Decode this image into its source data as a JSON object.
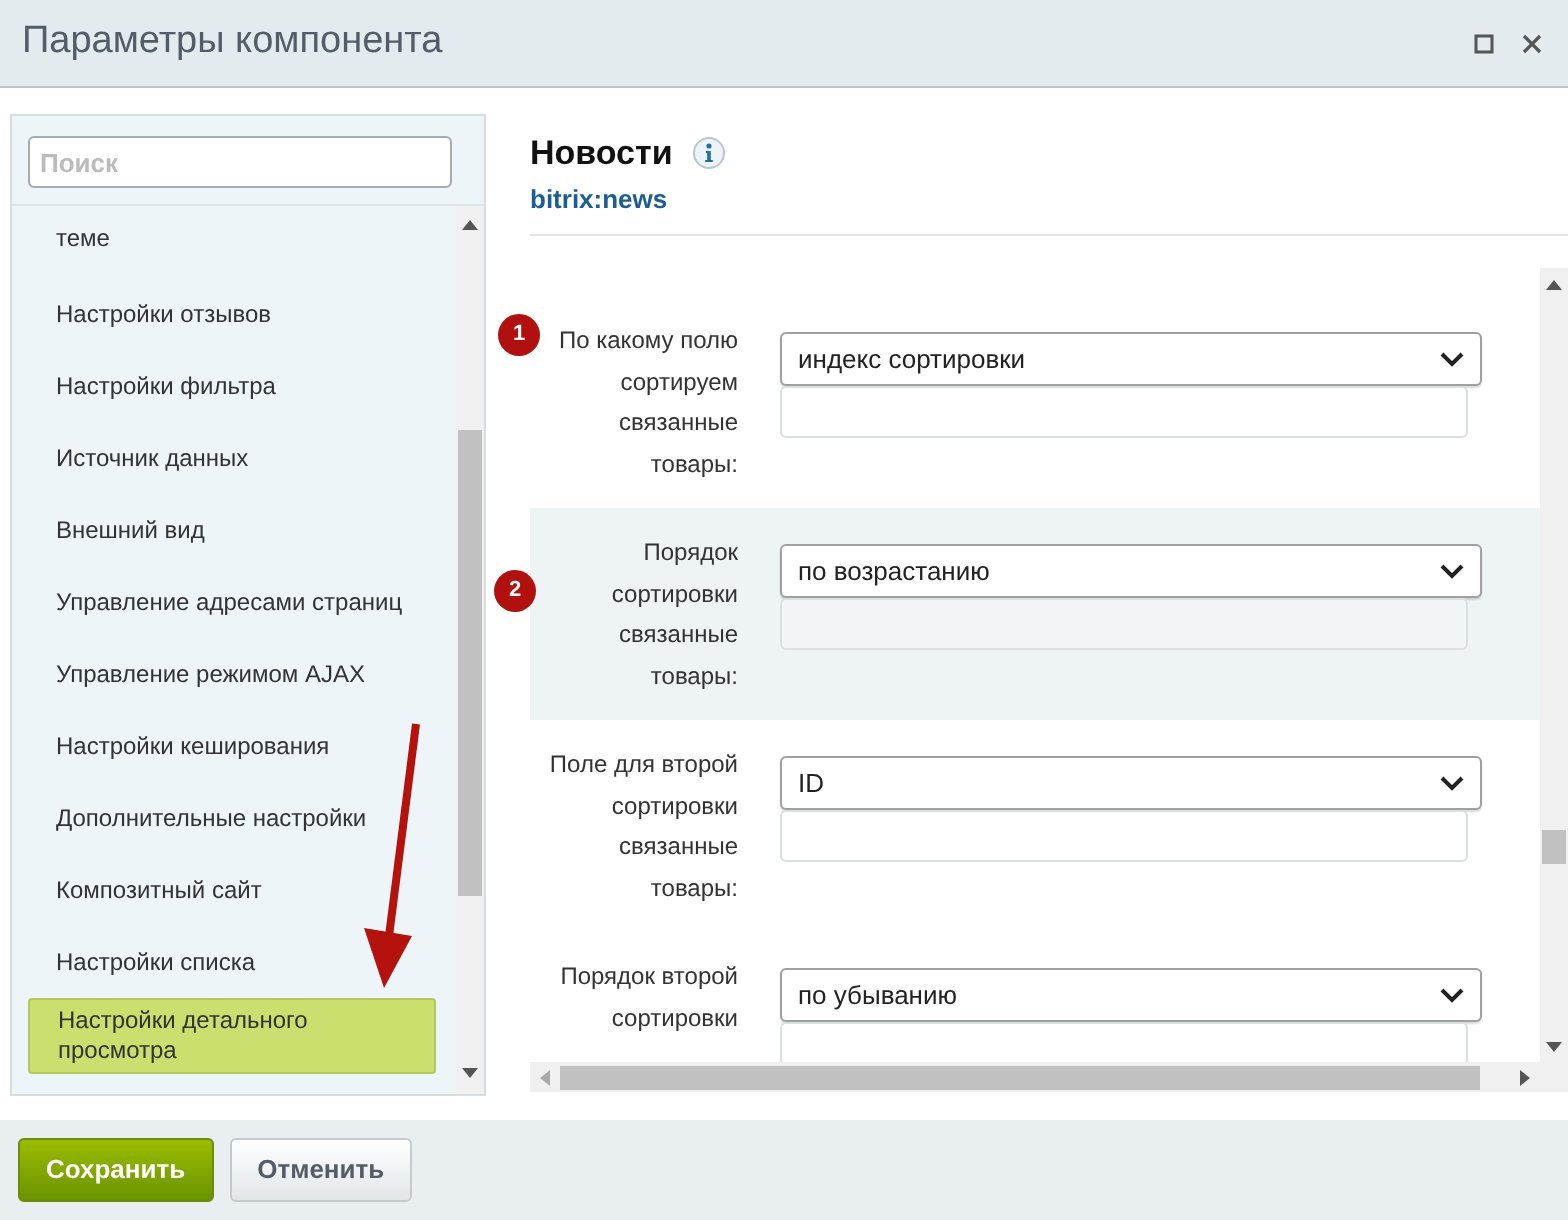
{
  "window": {
    "title": "Параметры компонента"
  },
  "sidebar": {
    "search": {
      "placeholder": "Поиск"
    },
    "items": [
      {
        "label": "теме",
        "selected": false
      },
      {
        "label": "Настройки отзывов",
        "selected": false
      },
      {
        "label": "Настройки фильтра",
        "selected": false
      },
      {
        "label": "Источник данных",
        "selected": false
      },
      {
        "label": "Внешний вид",
        "selected": false
      },
      {
        "label": "Управление адресами страниц",
        "selected": false
      },
      {
        "label": "Управление режимом AJAX",
        "selected": false
      },
      {
        "label": "Настройки кеширования",
        "selected": false
      },
      {
        "label": "Дополнительные настройки",
        "selected": false
      },
      {
        "label": "Композитный сайт",
        "selected": false
      },
      {
        "label": "Настройки списка",
        "selected": false
      },
      {
        "label": "Настройки детального просмотра",
        "selected": true
      }
    ]
  },
  "component": {
    "name": "Новости",
    "code": "bitrix:news"
  },
  "fields": [
    {
      "label": "По какому полю сортируем связанные товары:",
      "value": "индекс сортировки",
      "badge": "1",
      "highlighted": false
    },
    {
      "label": "Порядок сортировки связанные товары:",
      "value": "по возрастанию",
      "badge": "2",
      "highlighted": true
    },
    {
      "label": "Поле для второй сортировки связанные товары:",
      "value": "ID",
      "highlighted": false
    },
    {
      "label": "Порядок второй сортировки",
      "value": "по убыванию",
      "highlighted": false
    }
  ],
  "buttons": [
    {
      "label": "Сохранить",
      "kind": "primary"
    },
    {
      "label": "Отменить",
      "kind": "secondary"
    }
  ]
}
